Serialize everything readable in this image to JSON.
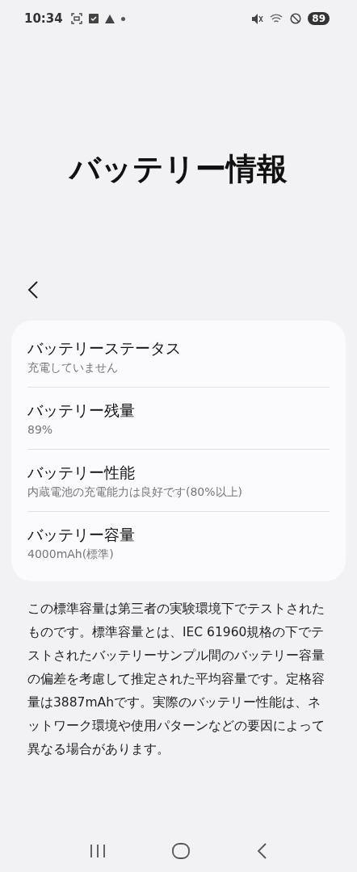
{
  "status_bar": {
    "time": "10:34",
    "battery": "89"
  },
  "title": "バッテリー情報",
  "items": [
    {
      "title": "バッテリーステータス",
      "subtitle": "充電していません"
    },
    {
      "title": "バッテリー残量",
      "subtitle": "89%"
    },
    {
      "title": "バッテリー性能",
      "subtitle": "内蔵電池の充電能力は良好です(80%以上)"
    },
    {
      "title": "バッテリー容量",
      "subtitle": "4000mAh(標準)"
    }
  ],
  "note": "この標準容量は第三者の実験環境下でテストされたものです。標準容量とは、IEC 61960規格の下でテストされたバッテリーサンプル間のバッテリー容量の偏差を考慮して推定された平均容量です。定格容量は3887mAhです。実際のバッテリー性能は、ネットワーク環境や使用パターンなどの要因によって異なる場合があります。"
}
